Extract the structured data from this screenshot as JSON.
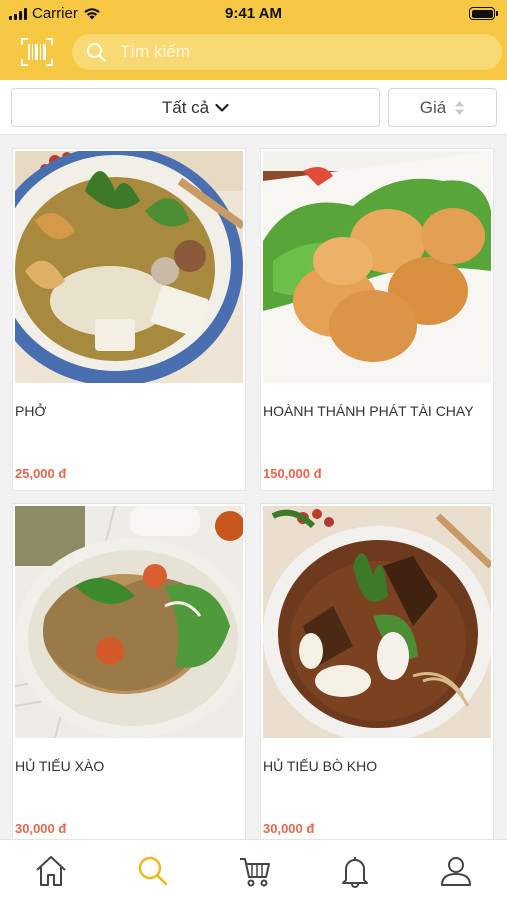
{
  "status_bar": {
    "carrier": "Carrier",
    "time": "9:41 AM"
  },
  "header": {
    "search_placeholder": "Tìm kiếm",
    "accent_color": "#f6c843"
  },
  "filters": {
    "category_label": "Tất cả",
    "sort_label": "Giá"
  },
  "products": [
    {
      "name": "PHỞ",
      "price": "25,000 đ"
    },
    {
      "name": "HOÀNH THÁNH PHÁT TÀI CHAY",
      "price": "150,000 đ"
    },
    {
      "name": "HỦ TIẾU XÀO",
      "price": "30,000 đ"
    },
    {
      "name": "HỦ TIẾU BÒ KHO",
      "price": "30,000 đ"
    }
  ],
  "tab_bar": {
    "items": [
      {
        "icon": "home-icon",
        "active": false
      },
      {
        "icon": "search-icon",
        "active": true
      },
      {
        "icon": "cart-icon",
        "active": false
      },
      {
        "icon": "bell-icon",
        "active": false
      },
      {
        "icon": "user-icon",
        "active": false
      }
    ],
    "active_color": "#f0b81c"
  },
  "colors": {
    "price": "#e8664a"
  }
}
